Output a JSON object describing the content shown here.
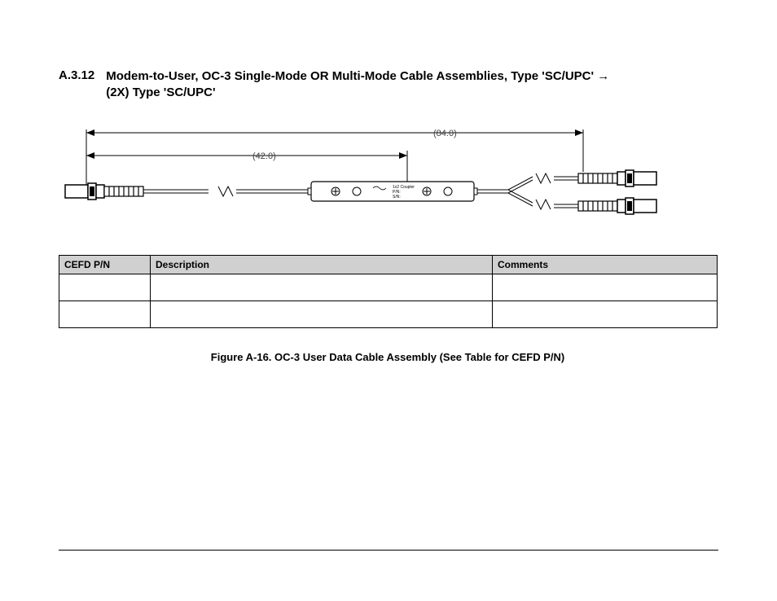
{
  "heading": {
    "number": "A.3.12",
    "line1": "Modem-to-User, OC-3 Single-Mode OR Multi-Mode Cable Assemblies, Type 'SC/UPC' ",
    "arrow": "→",
    "line2": "(2X) Type 'SC/UPC'"
  },
  "figure": {
    "dim_full": "(84.0)",
    "dim_half": "(42.0)",
    "coupler_line1": "1x2 Coupler",
    "coupler_line2": "P/N:",
    "coupler_line3": "S/N:"
  },
  "table": {
    "headers": {
      "c1": "CEFD P/N",
      "c2": "Description",
      "c3": "Comments"
    },
    "rows": [
      {
        "c1": "",
        "c2": "",
        "c3": ""
      },
      {
        "c1": "",
        "c2": "",
        "c3": ""
      }
    ]
  },
  "caption": "Figure A-16. OC-3 User Data Cable Assembly (See Table for CEFD P/N)"
}
